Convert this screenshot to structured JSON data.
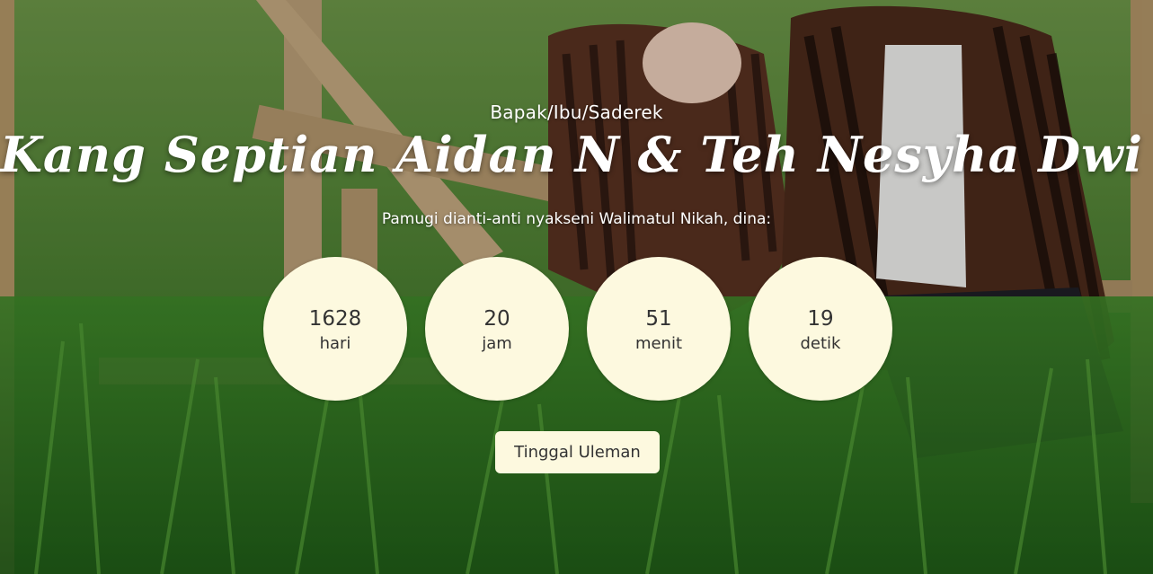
{
  "hero": {
    "greeting": "Bapak/Ibu/Saderek",
    "couple_names": "Kang Septian Aidan N & Teh Nesyha Dwi F",
    "invitation_text": "Pamugi dianti-anti nyakseni Walimatul Nikah, dina:"
  },
  "countdown": {
    "days": {
      "value": "1628",
      "unit": "hari"
    },
    "hours": {
      "value": "20",
      "unit": "jam"
    },
    "minutes": {
      "value": "51",
      "unit": "menit"
    },
    "seconds": {
      "value": "19",
      "unit": "detik"
    }
  },
  "actions": {
    "save_invitation_label": "Tinggal Uleman"
  },
  "colors": {
    "circle_bg": "#fdf9df",
    "text_dark": "#333333",
    "text_light": "#ffffff"
  }
}
